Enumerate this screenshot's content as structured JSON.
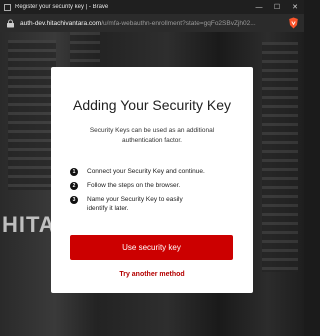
{
  "window": {
    "title": "Register your security key | - Brave",
    "controls": {
      "minimize": "—",
      "maximize": "☐",
      "close": "✕"
    }
  },
  "addressbar": {
    "host": "auth-dev.hitachivantara.com",
    "path": "/u/mfa-webauthn-enrollment?state=gqFo2SBvZjh02..."
  },
  "background": {
    "logo_text": "HITA"
  },
  "modal": {
    "title": "Adding Your Security Key",
    "description": "Security Keys can be used as an additional authentication factor.",
    "steps": [
      {
        "num": "1",
        "text": "Connect your Security Key and continue."
      },
      {
        "num": "2",
        "text": "Follow the steps on the browser."
      },
      {
        "num": "3",
        "text": "Name your Security Key to easily identify it later."
      }
    ],
    "primary_button": "Use security key",
    "secondary_link": "Try another method"
  },
  "colors": {
    "accent": "#cc0000",
    "link": "#b30000"
  }
}
